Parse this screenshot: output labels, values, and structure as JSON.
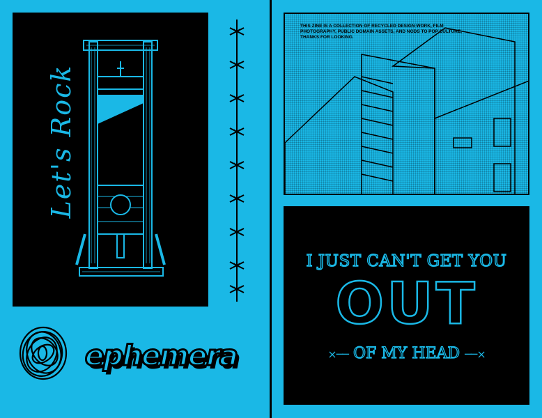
{
  "colors": {
    "background": "#1ab8e6",
    "ink": "#000000"
  },
  "left_poster": {
    "script_text": "Let's Rock",
    "illustration": "guillotine"
  },
  "decoration": {
    "barbed_wire": "barbed-wire",
    "scribble": "scribble-ball"
  },
  "photo_panel": {
    "caption": "THIS ZINE IS A COLLECTION OF RECYCLED DESIGN WORK, FILM PHOTOGRAPHY, PUBLIC DOMAIN ASSETS, AND NODS TO POP CULTURE, THANKS FOR LOOKING.",
    "illustration": "building-photo"
  },
  "quote_panel": {
    "line1": "I JUST CAN'T GET YOU",
    "line2": "OUT",
    "line3": "OF MY HEAD",
    "ornament": "×──"
  },
  "logo": {
    "text": "ephemera"
  }
}
